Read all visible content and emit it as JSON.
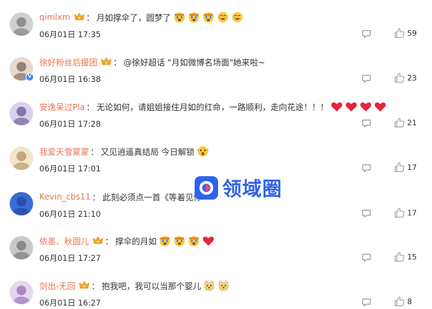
{
  "comments": [
    {
      "user": "qimlxm",
      "vip": true,
      "text": "月如撑伞了，圆梦了",
      "emojis": [
        "cry",
        "cry",
        "cry",
        "laugh",
        "laugh"
      ],
      "time": "06月01日 17:35",
      "likes": "59",
      "verified": false
    },
    {
      "user": "徐好粉丝后援团",
      "vip": true,
      "text": "@徐好超话 \"月如微博名场面\"她来啦~",
      "emojis": [],
      "time": "06月01日 16:38",
      "likes": "23",
      "verified": true
    },
    {
      "user": "安逸呆过Pla",
      "vip": false,
      "text": "无论如何，请姐姐接住月如的红命，一路顺利，走向花途！！！",
      "emojis": [
        "heart",
        "heart",
        "heart",
        "heart"
      ],
      "time": "06月01日 17:28",
      "likes": "21",
      "verified": false
    },
    {
      "user": "我爱天雪蒙蒙",
      "vip": false,
      "text": "又见逍遥真结局 今日解锁",
      "emojis": [
        "shock"
      ],
      "time": "06月01日 17:01",
      "likes": "17",
      "verified": false
    },
    {
      "user": "Kevin_cbs11",
      "vip": false,
      "text": "此刻必须点一首《等着见你",
      "emojis": [],
      "time": "06月01日 21:10",
      "likes": "17",
      "verified": false
    },
    {
      "user": "依墨、秋圆儿",
      "vip": true,
      "text": "撑伞的月如",
      "emojis": [
        "cry",
        "cry",
        "cry",
        "heart"
      ],
      "time": "06月01日 17:27",
      "likes": "15",
      "verified": false
    },
    {
      "user": "剑出-无回",
      "vip": true,
      "text": "抱我吧，我可以当那个婴儿",
      "emojis": [
        "dog",
        "dog"
      ],
      "time": "06月01日 16:27",
      "likes": "8",
      "verified": false
    }
  ],
  "watermark": {
    "text": "领域圈"
  },
  "colors": {
    "name": "#eb7350",
    "text": "#333333",
    "icon": "#9a9a9a",
    "watermark": "#2f63e9"
  }
}
